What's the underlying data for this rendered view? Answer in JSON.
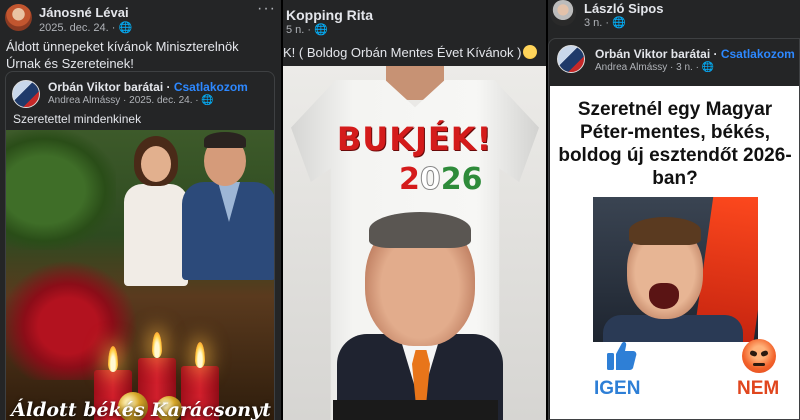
{
  "panel1": {
    "author": "Jánosné Lévai",
    "meta": "2025. dec. 24. · 🌐",
    "more": "···",
    "text": "Áldott ünnepeket kívánok Miniszterelnök Úrnak és Szereteinek!",
    "shared": {
      "page": "Orbán Viktor barátai",
      "separator": " · ",
      "join": "Csatlakozom",
      "meta": "Andrea Almássy · 2025. dec. 24. · 🌐",
      "text": "Szeretettel mindenkinek",
      "image_text": "Áldott békés Karácsonyt mindenkinek"
    }
  },
  "panel2": {
    "author": "Kopping Rita",
    "meta": "5 n. · 🌐",
    "text": "K! ( Boldog Orbán Mentes Évet Kívánok )",
    "shirt_slogan": "BUKJÉK!",
    "shirt_year": [
      "2",
      "0",
      "2",
      "6"
    ]
  },
  "panel3": {
    "author": "László Sipos",
    "meta": "3 n. · 🌐",
    "shared": {
      "page": "Orbán Viktor barátai",
      "separator": " · ",
      "join": "Csatlakozom",
      "meta": "Andrea Almássy · 3 n. · 🌐",
      "question": "Szeretnél egy Magyar Péter-mentes, békés, boldog új esztendőt 2026-ban?",
      "yes": "IGEN",
      "no": "NEM"
    }
  },
  "colors": {
    "card_bg": "#242526",
    "link_blue": "#2d88ff",
    "yes_blue": "#2e7fd6",
    "no_orange": "#e0461e"
  }
}
